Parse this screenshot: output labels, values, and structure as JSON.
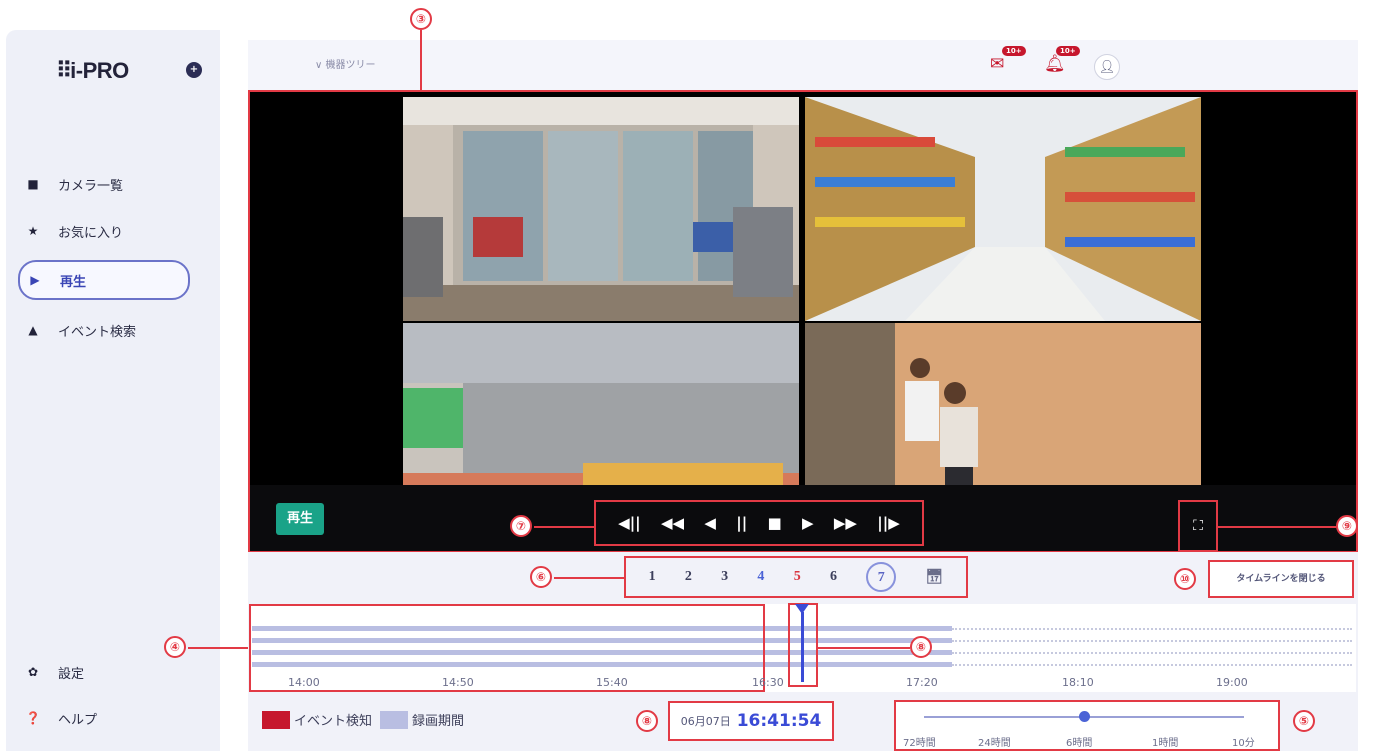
{
  "app": {
    "logo": "i-PRO",
    "logo_icon": "plus-circle-icon"
  },
  "sidebar": {
    "items": [
      {
        "label": "カメラ一覧",
        "icon": "video-camera-icon",
        "glyph": "■"
      },
      {
        "label": "お気に入り",
        "icon": "star-icon",
        "glyph": "★"
      },
      {
        "label": "再生",
        "icon": "play-icon",
        "glyph": "▶",
        "active": true
      },
      {
        "label": "イベント検索",
        "icon": "bell-icon",
        "glyph": "▲"
      }
    ],
    "bottom": [
      {
        "label": "設定",
        "icon": "gear-icon",
        "glyph": "✿"
      },
      {
        "label": "ヘルプ",
        "icon": "help-icon",
        "glyph": "❓"
      }
    ]
  },
  "header": {
    "tree": "∨ 機器ツリー",
    "mail_badge": "10+",
    "bell_badge": "10+"
  },
  "video": {
    "status_badge": "再生",
    "controls": [
      "◀||",
      "◀◀",
      "◀",
      "||",
      "■",
      "▶",
      "▶▶",
      "||▶"
    ],
    "fullscreen_glyph": "⛶"
  },
  "layout_pages": {
    "pages": [
      "1",
      "2",
      "3",
      "4",
      "5",
      "6",
      "7"
    ],
    "calendar_icon": "calendar-icon"
  },
  "close_timeline_label": "タイムラインを閉じる",
  "timeline": {
    "ticks": [
      "14:00",
      "14:50",
      "15:40",
      "16:30",
      "17:20",
      "18:10",
      "19:00"
    ]
  },
  "legend": {
    "event": "イベント検知",
    "record": "録画期間",
    "event_color": "#c6172d",
    "record_color": "#b9bee2"
  },
  "time_display": {
    "date": "06月07日",
    "time": "16:41:54"
  },
  "zoom": {
    "labels": [
      "72時間",
      "24時間",
      "6時間",
      "1時間",
      "10分"
    ],
    "selected": "6時間"
  },
  "callouts": [
    "③",
    "④",
    "⑤",
    "⑥",
    "⑦",
    "⑧",
    "⑧",
    "⑨",
    "⑩"
  ]
}
